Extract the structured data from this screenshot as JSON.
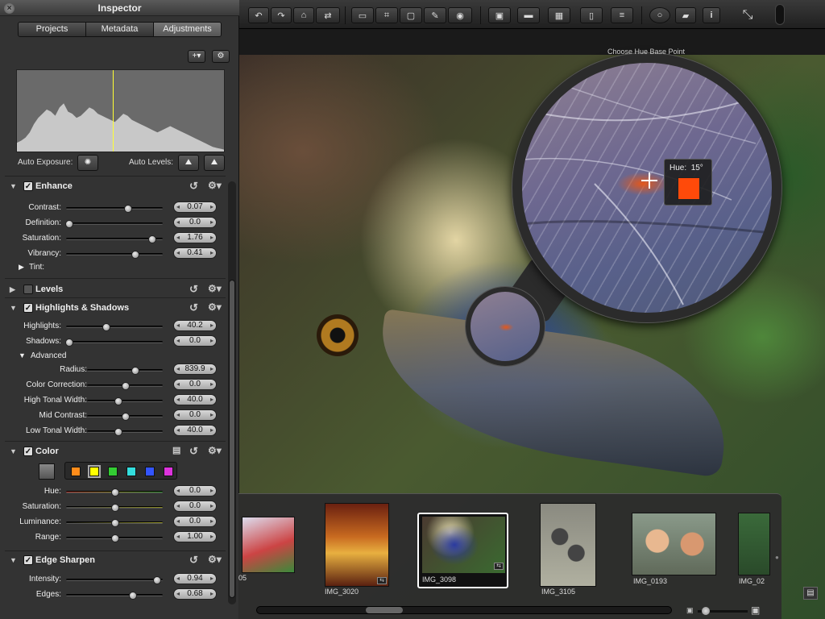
{
  "toolbar": {
    "icons": [
      "rotate-left-icon",
      "rotate-right-icon",
      "straighten-icon",
      "flip-icon",
      "stamp-icon",
      "crop-icon",
      "select-icon",
      "brush-icon",
      "redeye-icon",
      "presentation-icon",
      "viewer-icon",
      "split-view-icon",
      "one-up-icon",
      "filmstrip-view-icon",
      "loupe-icon",
      "badge-icon",
      "info-icon",
      "fullscreen-exit-icon"
    ],
    "info_glyph": "i"
  },
  "inspector": {
    "title": "Inspector",
    "close_glyph": "×",
    "tabs": [
      {
        "label": "Projects",
        "active": false
      },
      {
        "label": "Metadata",
        "active": false
      },
      {
        "label": "Adjustments",
        "active": true
      }
    ],
    "add_button_label": "+",
    "auto_exposure_label": "Auto Exposure:",
    "auto_levels_label": "Auto Levels:",
    "histogram_values": [
      10,
      12,
      15,
      20,
      28,
      34,
      38,
      42,
      40,
      36,
      44,
      48,
      40,
      38,
      34,
      36,
      40,
      44,
      42,
      38,
      36,
      34,
      32,
      30,
      34,
      38,
      36,
      32,
      30,
      28,
      26,
      24,
      22,
      20,
      22,
      24,
      26,
      24,
      22,
      20,
      18,
      16,
      14,
      12,
      10,
      8,
      6,
      5,
      4,
      3
    ],
    "sections": {
      "enhance": {
        "name": "Enhance",
        "checked": true,
        "rows": [
          {
            "label": "Contrast:",
            "value": "0.07",
            "pos": 0.64
          },
          {
            "label": "Definition:",
            "value": "0.0",
            "pos": 0.03
          },
          {
            "label": "Saturation:",
            "value": "1.76",
            "pos": 0.89
          },
          {
            "label": "Vibrancy:",
            "value": "0.41",
            "pos": 0.72
          }
        ],
        "tint_label": "Tint:"
      },
      "levels": {
        "name": "Levels",
        "checked": false
      },
      "highlights_shadows": {
        "name": "Highlights & Shadows",
        "checked": true,
        "rows": [
          {
            "label": "Highlights:",
            "value": "40.2",
            "pos": 0.42
          },
          {
            "label": "Shadows:",
            "value": "0.0",
            "pos": 0.03
          }
        ],
        "advanced_label": "Advanced",
        "advanced_rows": [
          {
            "label": "Radius:",
            "value": "839.9",
            "pos": 0.64
          },
          {
            "label": "Color Correction:",
            "value": "0.0",
            "pos": 0.51
          },
          {
            "label": "High Tonal Width:",
            "value": "40.0",
            "pos": 0.41
          },
          {
            "label": "Mid Contrast:",
            "value": "0.0",
            "pos": 0.51
          },
          {
            "label": "Low Tonal Width:",
            "value": "40.0",
            "pos": 0.41
          }
        ]
      },
      "color": {
        "name": "Color",
        "checked": true,
        "swatches": [
          "#ff8c1a",
          "#ffff00",
          "#33cc33",
          "#33dddd",
          "#3355ff",
          "#dd33dd"
        ],
        "rows": [
          {
            "label": "Hue:",
            "value": "0.0",
            "pos": 0.51
          },
          {
            "label": "Saturation:",
            "value": "0.0",
            "pos": 0.51
          },
          {
            "label": "Luminance:",
            "value": "0.0",
            "pos": 0.51
          },
          {
            "label": "Range:",
            "value": "1.00",
            "pos": 0.51
          }
        ]
      },
      "edge_sharpen": {
        "name": "Edge Sharpen",
        "checked": true,
        "rows": [
          {
            "label": "Intensity:",
            "value": "0.94",
            "pos": 0.94
          },
          {
            "label": "Edges:",
            "value": "0.68",
            "pos": 0.69
          }
        ]
      }
    }
  },
  "loupe": {
    "title": "Choose Hue Base Point",
    "hue_label": "Hue:",
    "hue_value": "15°",
    "hue_color": "#ff4a0a"
  },
  "filmstrip": {
    "items": [
      {
        "label": "05",
        "selected": false
      },
      {
        "label": "IMG_3020",
        "selected": false
      },
      {
        "label": "IMG_3098",
        "selected": true
      },
      {
        "label": "IMG_3105",
        "selected": false
      },
      {
        "label": "IMG_0193",
        "selected": false
      },
      {
        "label": "IMG_02",
        "selected": false
      }
    ]
  }
}
